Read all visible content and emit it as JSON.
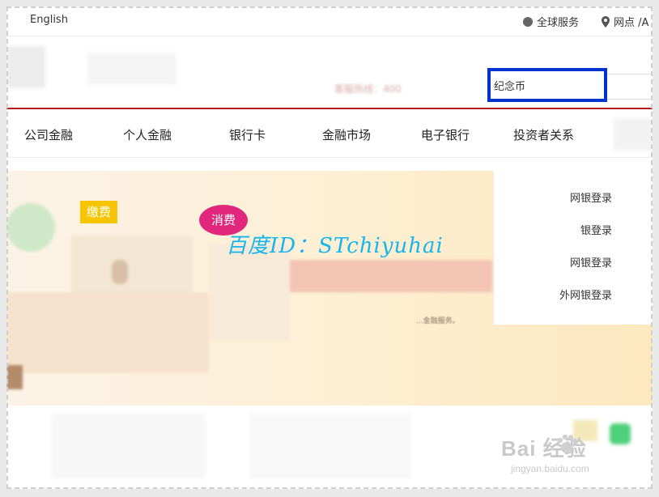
{
  "topbar": {
    "lang_link": "English",
    "global_service": "全球服务",
    "branch": "网点 /A"
  },
  "header": {
    "hotline": "客服热线：400",
    "search_value": "纪念币"
  },
  "nav": {
    "items": [
      "公司金融",
      "个人金融",
      "银行卡",
      "金融市场",
      "电子银行",
      "投资者关系"
    ]
  },
  "banner": {
    "tag_pay": "缴费",
    "tag_consume": "消费",
    "watermark": "百度ID：STchiyuhai",
    "subtext": "...金融服务。"
  },
  "login_panel": {
    "items": [
      "网银登录",
      "银登录",
      "网银登录",
      "外网银登录"
    ]
  },
  "footer_watermark": {
    "logo": "Bai 经验",
    "url": "jingyan.baidu.com"
  },
  "colors": {
    "accent_red": "#b31b1b",
    "search_highlight": "#0033cc",
    "watermark_blue": "#15b5ee"
  }
}
